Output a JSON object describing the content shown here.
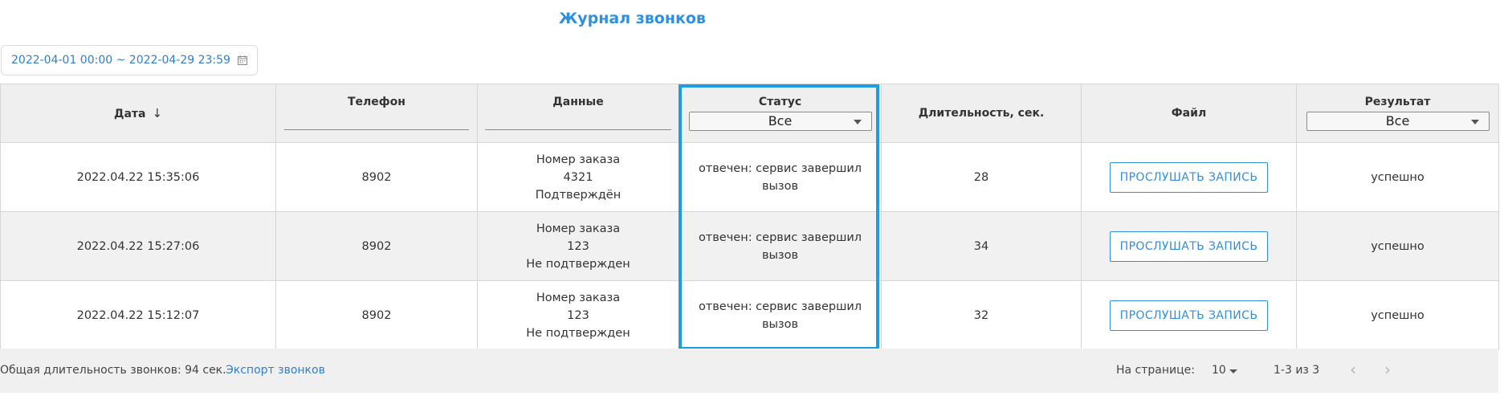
{
  "page": {
    "title": "Журнал звонков"
  },
  "filters": {
    "date_range": "2022-04-01 00:00 ~ 2022-04-29 23:59"
  },
  "table": {
    "headers": {
      "date": "Дата",
      "phone": "Телефон",
      "data": "Данные",
      "status": "Статус",
      "duration": "Длительность, сек.",
      "file": "Файл",
      "result": "Результат"
    },
    "status_filter": "Все",
    "result_filter": "Все",
    "rows": [
      {
        "date": "2022.04.22 15:35:06",
        "phone": "8902",
        "data1": "Номер заказа",
        "data2": "4321",
        "data3": "Подтверждён",
        "status1": "отвечен: сервис завершил",
        "status2": "вызов",
        "duration": "28",
        "file_btn": "ПРОСЛУШАТЬ ЗАПИСЬ",
        "result": "успешно"
      },
      {
        "date": "2022.04.22 15:27:06",
        "phone": "8902",
        "data1": "Номер заказа",
        "data2": "123",
        "data3": "Не подтвержден",
        "status1": "отвечен: сервис завершил",
        "status2": "вызов",
        "duration": "34",
        "file_btn": "ПРОСЛУШАТЬ ЗАПИСЬ",
        "result": "успешно"
      },
      {
        "date": "2022.04.22 15:12:07",
        "phone": "8902",
        "data1": "Номер заказа",
        "data2": "123",
        "data3": "Не подтвержден",
        "status1": "отвечен: сервис завершил",
        "status2": "вызов",
        "duration": "32",
        "file_btn": "ПРОСЛУШАТЬ ЗАПИСЬ",
        "result": "успешно"
      }
    ]
  },
  "footer": {
    "total_duration": "Общая длительность звонков: 94 сек.",
    "export_link": "Экспорт звонков",
    "per_page_label": "На странице:",
    "per_page_value": "10",
    "range_text": "1-3 из 3"
  },
  "icons": {
    "calendar": "calendar-icon",
    "sort": "arrow-down-icon",
    "dropdown": "caret-down-icon",
    "prev": "chevron-left-icon",
    "next": "chevron-right-icon"
  },
  "colors": {
    "accent": "#2f8fe3",
    "highlight": "#1a9ee0",
    "header_bg": "#efefef",
    "stripe_bg": "#f1f1f1"
  }
}
